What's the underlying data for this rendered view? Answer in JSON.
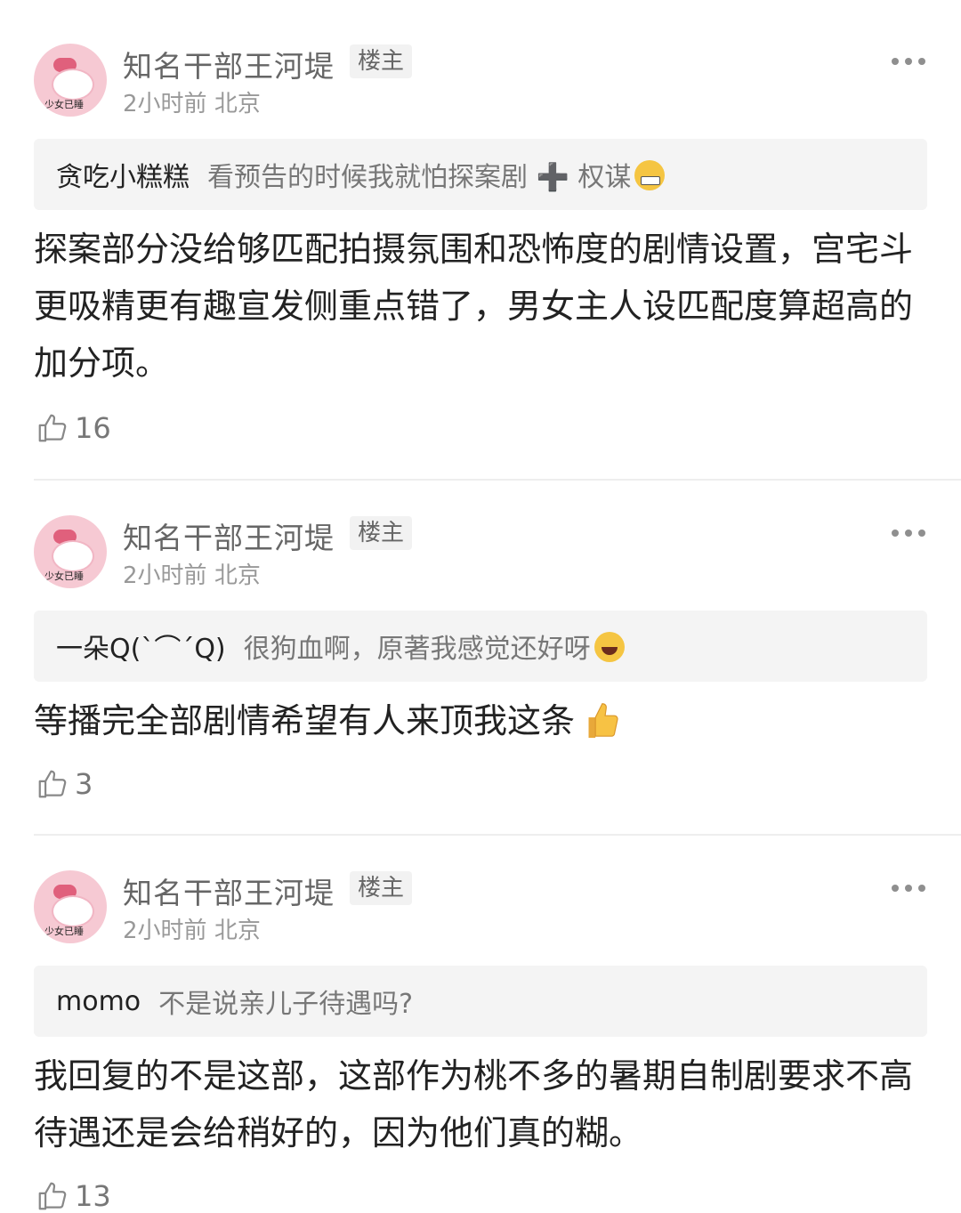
{
  "comments": [
    {
      "username": "知名干部王河堤",
      "badge": "楼主",
      "time": "2小时前",
      "location": "北京",
      "avatar_caption": "少女已睡",
      "quote_user": "贪吃小糕糕",
      "quote_text": "看预告的时候我就怕探案剧 ➕ 权谋",
      "quote_emoji": "grimacing-face",
      "text": "探案部分没给够匹配拍摄氛围和恐怖度的剧情设置，宫宅斗更吸精更有趣宣发侧重点错了，男女主人设匹配度算超高的加分项。",
      "likes": "16"
    },
    {
      "username": "知名干部王河堤",
      "badge": "楼主",
      "time": "2小时前",
      "location": "北京",
      "avatar_caption": "少女已睡",
      "quote_user": "一朵Q(`⌒´Q)",
      "quote_text": "很狗血啊，原著我感觉还好呀",
      "quote_emoji": "tears-of-joy",
      "text": "等播完全部剧情希望有人来顶我这条",
      "text_emoji": "thumbs-up",
      "likes": "3"
    },
    {
      "username": "知名干部王河堤",
      "badge": "楼主",
      "time": "2小时前",
      "location": "北京",
      "avatar_caption": "少女已睡",
      "quote_user": "momo",
      "quote_text": "不是说亲儿子待遇吗?",
      "text": "我回复的不是这部，这部作为桃不多的暑期自制剧要求不高待遇还是会给稍好的，因为他们真的糊。",
      "likes": "13"
    }
  ],
  "colors": {
    "background": "#ffffff",
    "username": "#666666",
    "body_text": "#222222",
    "quote_bg": "#f4f4f4"
  }
}
